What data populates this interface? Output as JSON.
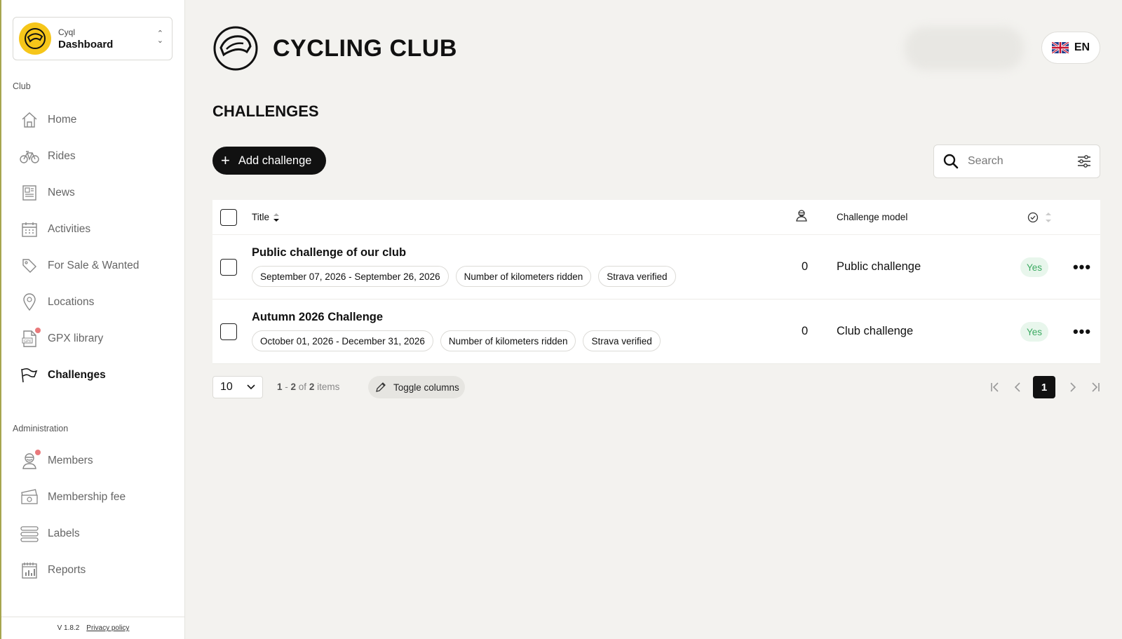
{
  "sidebar": {
    "org_name": "Cyql",
    "app_name": "Dashboard",
    "sections": {
      "club": "Club",
      "administration": "Administration"
    },
    "club_items": [
      {
        "label": "Home",
        "icon": "home-icon"
      },
      {
        "label": "Rides",
        "icon": "bicycle-icon"
      },
      {
        "label": "News",
        "icon": "newspaper-icon"
      },
      {
        "label": "Activities",
        "icon": "calendar-icon"
      },
      {
        "label": "For Sale & Wanted",
        "icon": "tag-icon"
      },
      {
        "label": "Locations",
        "icon": "location-pin-icon"
      },
      {
        "label": "GPX library",
        "icon": "gpx-file-icon",
        "badge": true
      },
      {
        "label": "Challenges",
        "icon": "flag-icon",
        "active": true
      }
    ],
    "admin_items": [
      {
        "label": "Members",
        "icon": "member-icon",
        "badge": true
      },
      {
        "label": "Membership fee",
        "icon": "money-icon"
      },
      {
        "label": "Labels",
        "icon": "labels-icon"
      },
      {
        "label": "Reports",
        "icon": "reports-icon"
      }
    ],
    "footer": {
      "version": "V 1.8.2",
      "privacy": "Privacy policy"
    }
  },
  "header": {
    "club_name": "CYCLING CLUB",
    "language": "EN"
  },
  "page": {
    "title": "CHALLENGES",
    "add_label": "Add challenge",
    "search_placeholder": "Search"
  },
  "table": {
    "columns": {
      "title": "Title",
      "model": "Challenge model"
    },
    "rows": [
      {
        "title": "Public challenge of our club",
        "dates": "September 07, 2026 - September 26, 2026",
        "metric": "Number of kilometers ridden",
        "verification": "Strava verified",
        "participants": "0",
        "model": "Public challenge",
        "verified": "Yes"
      },
      {
        "title": "Autumn 2026 Challenge",
        "dates": "October 01, 2026 - December 31, 2026",
        "metric": "Number of kilometers ridden",
        "verification": "Strava verified",
        "participants": "0",
        "model": "Club challenge",
        "verified": "Yes"
      }
    ]
  },
  "pagination": {
    "page_size": "10",
    "range_start": "1",
    "range_end": "2",
    "of_text": "of",
    "total": "2",
    "items_text": "items",
    "toggle_columns": "Toggle columns",
    "current_page": "1"
  },
  "colors": {
    "accent": "#111111",
    "logo_yellow": "#f6c61a",
    "badge_red": "#e9797b",
    "yes_green": "#3caa62"
  }
}
